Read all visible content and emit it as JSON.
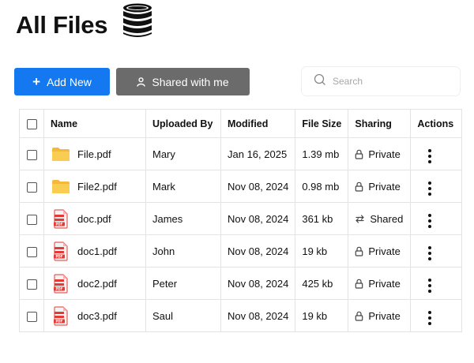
{
  "header": {
    "title": "All Files",
    "icon": "database-icon"
  },
  "toolbar": {
    "add_new_label": "Add New",
    "shared_with_me_label": "Shared with me",
    "search_placeholder": "Search",
    "search_value": ""
  },
  "colors": {
    "primary": "#1479f0",
    "secondary": "#6b6b6b",
    "pdf_red": "#e53935",
    "folder_yellow": "#f7c64a"
  },
  "table": {
    "columns": [
      "Name",
      "Uploaded By",
      "Modified",
      "File Size",
      "Sharing",
      "Actions"
    ],
    "rows": [
      {
        "icon": "folder-icon",
        "name": "File.pdf",
        "uploaded_by": "Mary",
        "modified": "Jan 16, 2025",
        "size": "1.39 mb",
        "sharing_icon": "lock-icon",
        "sharing": "Private"
      },
      {
        "icon": "folder-icon",
        "name": "File2.pdf",
        "uploaded_by": "Mark",
        "modified": "Nov 08, 2024",
        "size": "0.98 mb",
        "sharing_icon": "lock-icon",
        "sharing": "Private"
      },
      {
        "icon": "pdf-icon",
        "name": "doc.pdf",
        "uploaded_by": "James",
        "modified": "Nov 08, 2024",
        "size": "361 kb",
        "sharing_icon": "share-icon",
        "sharing": "Shared"
      },
      {
        "icon": "pdf-icon",
        "name": "doc1.pdf",
        "uploaded_by": "John",
        "modified": "Nov 08, 2024",
        "size": "19 kb",
        "sharing_icon": "lock-icon",
        "sharing": "Private"
      },
      {
        "icon": "pdf-icon",
        "name": "doc2.pdf",
        "uploaded_by": "Peter",
        "modified": "Nov 08, 2024",
        "size": "425 kb",
        "sharing_icon": "lock-icon",
        "sharing": "Private"
      },
      {
        "icon": "pdf-icon",
        "name": "doc3.pdf",
        "uploaded_by": "Saul",
        "modified": "Nov 08, 2024",
        "size": "19 kb",
        "sharing_icon": "lock-icon",
        "sharing": "Private"
      }
    ]
  }
}
